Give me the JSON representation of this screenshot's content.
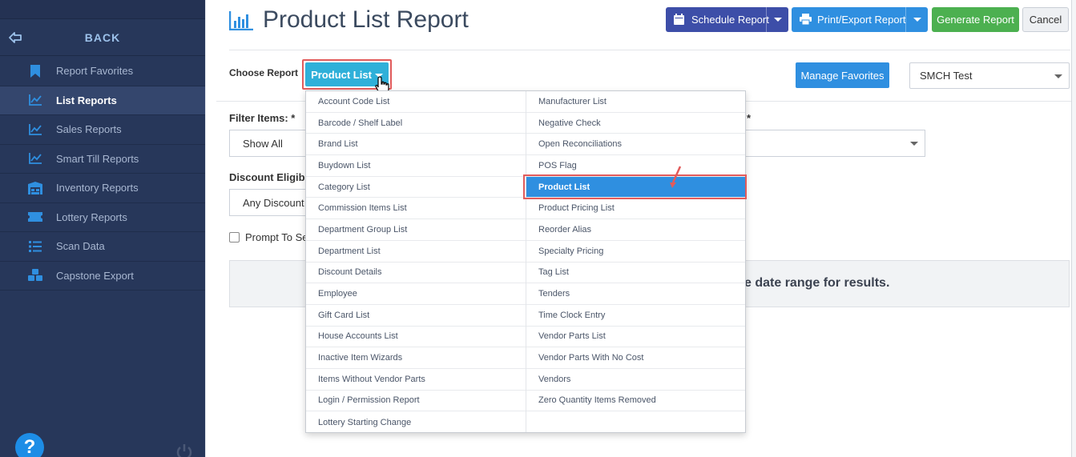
{
  "sidebar": {
    "back_label": "BACK",
    "items": [
      {
        "label": "Report Favorites",
        "icon": "bookmark-icon",
        "active": false
      },
      {
        "label": "List Reports",
        "icon": "chart-line-icon",
        "active": true
      },
      {
        "label": "Sales Reports",
        "icon": "chart-line-icon",
        "active": false
      },
      {
        "label": "Smart Till Reports",
        "icon": "chart-line-icon",
        "active": false
      },
      {
        "label": "Inventory Reports",
        "icon": "warehouse-icon",
        "active": false
      },
      {
        "label": "Lottery Reports",
        "icon": "ticket-icon",
        "active": false
      },
      {
        "label": "Scan Data",
        "icon": "list-icon",
        "active": false
      },
      {
        "label": "Capstone Export",
        "icon": "cubes-icon",
        "active": false
      }
    ],
    "help_label": "?"
  },
  "header": {
    "title": "Product List Report",
    "schedule_label": "Schedule Report",
    "print_label": "Print/Export Report",
    "generate_label": "Generate Report",
    "cancel_label": "Cancel"
  },
  "choose": {
    "label": "Choose Report",
    "selected": "Product List",
    "favorites_label": "Manage Favorites",
    "store_value": "SMCH Test"
  },
  "filters": {
    "filter_label": "Filter Items: *",
    "filter_value": "Show All",
    "right_star": "*",
    "discount_label": "Discount Eligibili",
    "discount_value": "Any Discount",
    "prompt_label": "Prompt To Se"
  },
  "info": {
    "text": "e date range for results."
  },
  "menu": {
    "left": [
      "Account Code List",
      "Barcode / Shelf Label",
      "Brand List",
      "Buydown List",
      "Category List",
      "Commission Items List",
      "Department Group List",
      "Department List",
      "Discount Details",
      "Employee",
      "Gift Card List",
      "House Accounts List",
      "Inactive Item Wizards",
      "Items Without Vendor Parts",
      "Login / Permission Report",
      "Lottery Starting Change"
    ],
    "right": [
      "Manufacturer List",
      "Negative Check",
      "Open Reconciliations",
      "POS Flag",
      "Product List",
      "Product Pricing List",
      "Reorder Alias",
      "Specialty Pricing",
      "Tag List",
      "Tenders",
      "Time Clock Entry",
      "Vendor Parts List",
      "Vendor Parts With No Cost",
      "Vendors",
      "Zero Quantity Items Removed",
      ""
    ],
    "selected_right_index": 4
  },
  "colors": {
    "sidebar_bg": "#27375a",
    "accent_blue": "#2f8fe0",
    "schedule_blue": "#3d4ea8",
    "generate_green": "#4cb050",
    "product_dd": "#2fb0d9",
    "highlight_red": "#e25b5b"
  }
}
